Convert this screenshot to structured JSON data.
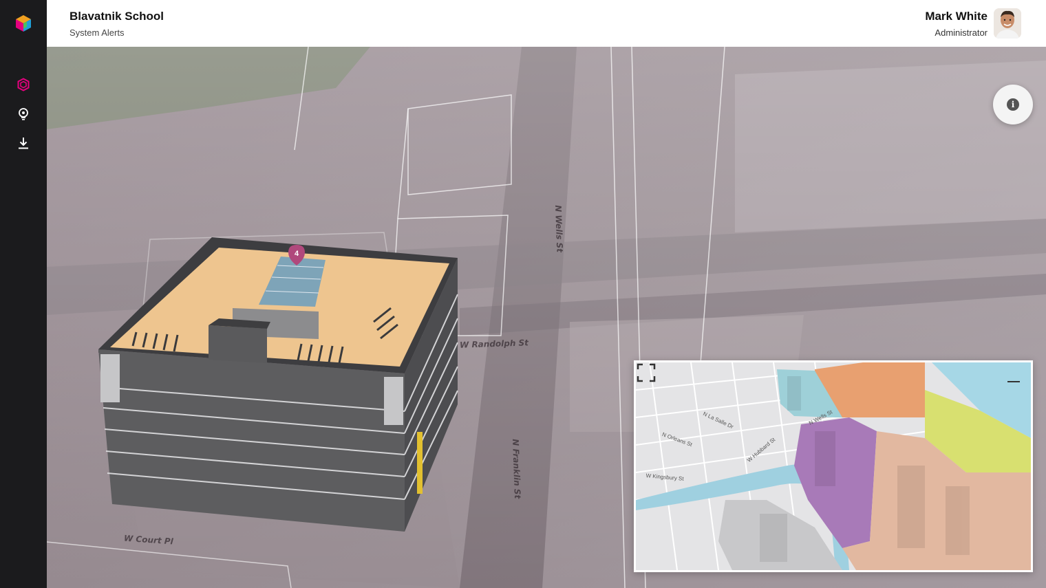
{
  "header": {
    "title": "Blavatnik School",
    "subtitle": "System Alerts"
  },
  "user": {
    "name": "Mark White",
    "role": "Administrator"
  },
  "sidebar": {
    "items": [
      {
        "icon": "cube-icon",
        "active": true,
        "color": "#e6007e"
      },
      {
        "icon": "location-bulb-icon",
        "active": false
      },
      {
        "icon": "download-icon",
        "active": false
      }
    ]
  },
  "map": {
    "marker_label": "4",
    "streets": [
      {
        "label": "W Randolph St"
      },
      {
        "label": "N Franklin St"
      },
      {
        "label": "W Court Pl"
      },
      {
        "label": "N Wells St"
      }
    ]
  },
  "minimap": {
    "streets": [
      {
        "label": "N Orleans St"
      },
      {
        "label": "N La Salle Dr"
      },
      {
        "label": "W Kingsbury St"
      },
      {
        "label": "W Hubbard St"
      },
      {
        "label": "N Wells St"
      }
    ],
    "district_colors": [
      "#e8a070",
      "#9ed0d8",
      "#a87ab8",
      "#e2b8a0",
      "#d8e070"
    ]
  },
  "colors": {
    "accent": "#e6007e",
    "roof": "#eec58f",
    "building": "#5c5c5e"
  }
}
